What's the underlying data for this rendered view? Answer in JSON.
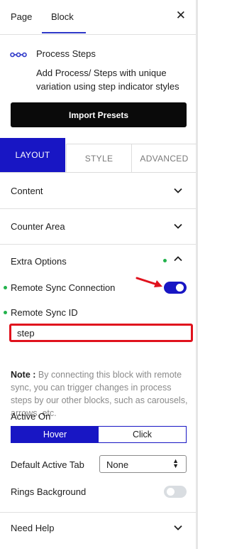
{
  "header": {
    "tabs": [
      "Page",
      "Block"
    ],
    "active_tab": "Block",
    "close_icon": "close-icon"
  },
  "block": {
    "icon": "process-steps-icon",
    "title": "Process Steps",
    "description": "Add Process/ Steps with unique variation using step indicator styles",
    "import_button": "Import Presets"
  },
  "panel_tabs": {
    "layout": "LAYOUT",
    "style": "STYLE",
    "advanced": "ADVANCED",
    "active": "LAYOUT"
  },
  "sections": {
    "content": "Content",
    "counter_area": "Counter Area",
    "extra_options": "Extra Options",
    "need_help": "Need Help"
  },
  "extra_options": {
    "remote_sync_connection": {
      "label": "Remote Sync Connection",
      "enabled": true
    },
    "remote_sync_id": {
      "label": "Remote Sync ID",
      "value": "step"
    },
    "note_label": "Note :",
    "note_text": "By connecting this block with remote sync, you can trigger changes in process steps by our other blocks, such as carousels, arrows, etc.",
    "active_on": {
      "label": "Active On",
      "options": [
        "Hover",
        "Click"
      ],
      "selected": "Hover"
    },
    "default_active_tab": {
      "label": "Default Active Tab",
      "value": "None"
    },
    "rings_background": {
      "label": "Rings Background",
      "enabled": false
    }
  },
  "colors": {
    "accent": "#1816c4",
    "highlight_border": "#e0121d",
    "indicator_dot": "#22b24c",
    "annotation_arrow": "#e0121d"
  }
}
